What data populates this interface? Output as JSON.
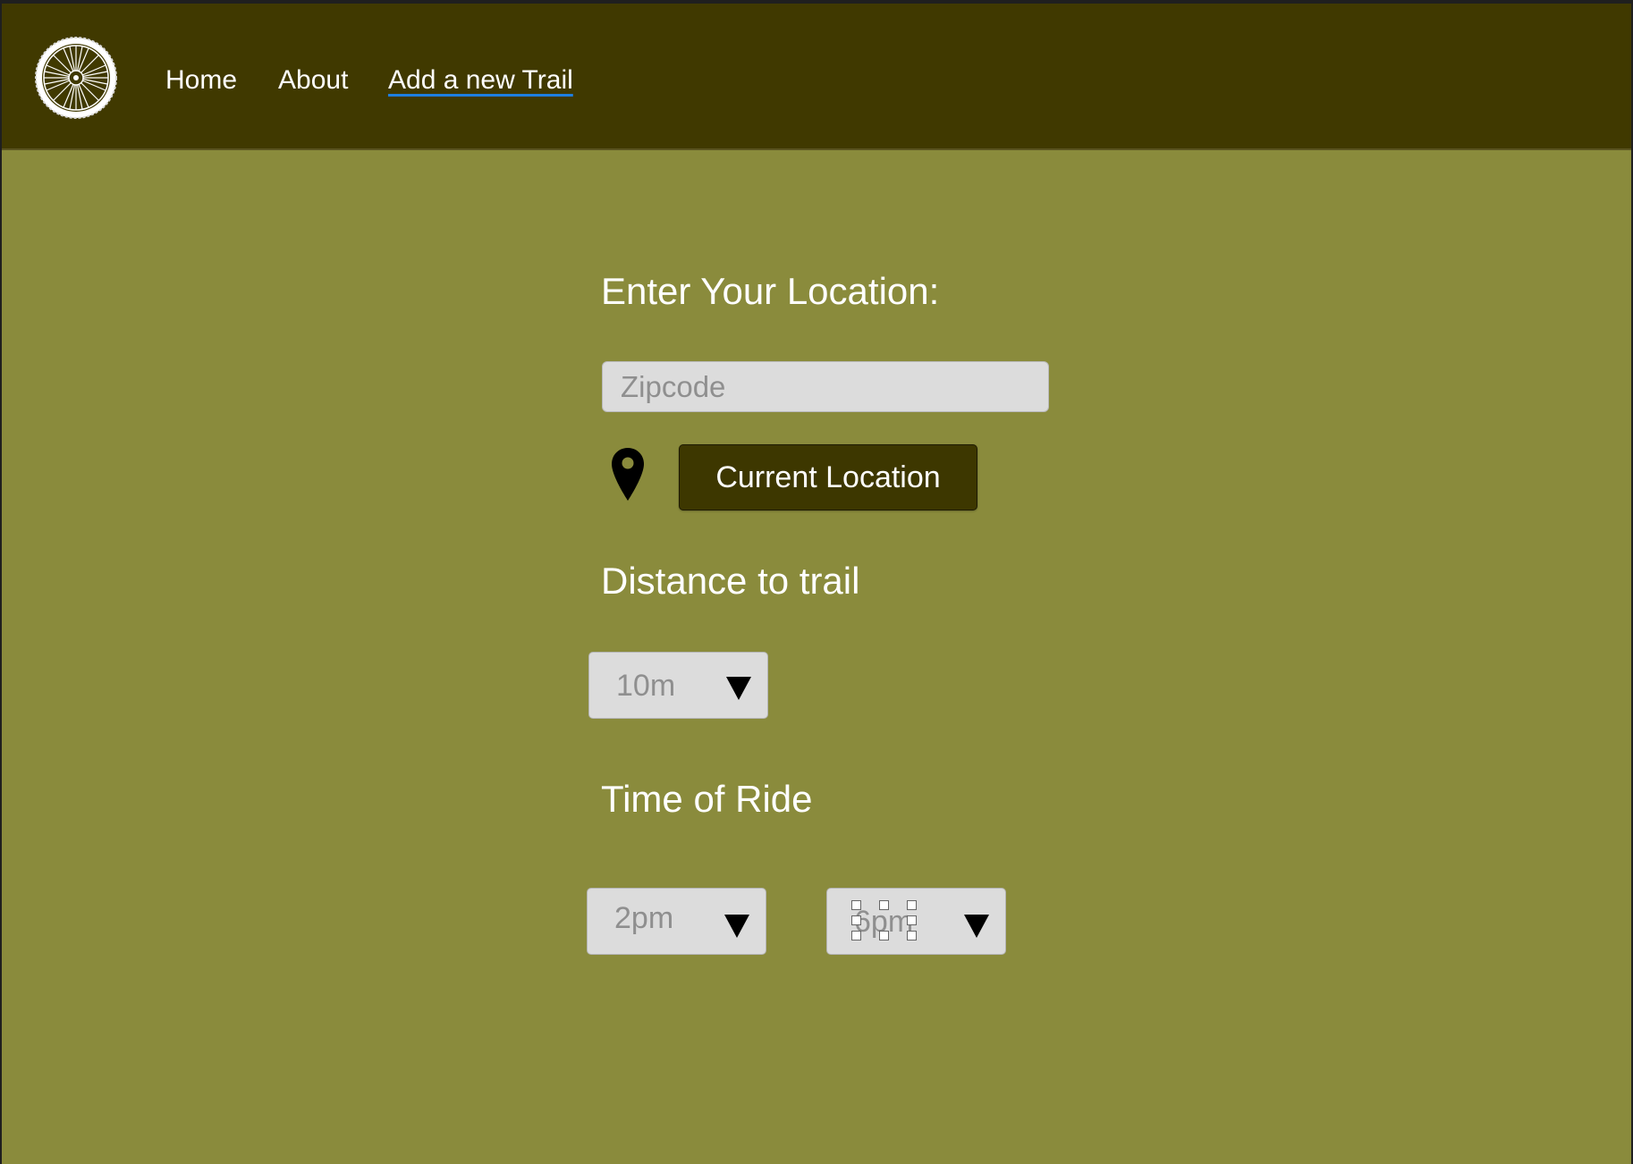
{
  "navbar": {
    "logo_icon": "bike-wheel-icon",
    "links": [
      {
        "label": "Home"
      },
      {
        "label": "About"
      },
      {
        "label": "Add a new Trail",
        "active": true
      }
    ]
  },
  "location": {
    "heading": "Enter Your Location:",
    "zip_placeholder": "Zipcode",
    "pin_icon": "map-pin-icon",
    "current_location_label": "Current Location"
  },
  "distance": {
    "heading": "Distance to trail",
    "selected": "10m"
  },
  "time": {
    "heading": "Time of Ride",
    "start_selected": "2pm",
    "end_selected": "6pm"
  },
  "colors": {
    "navbar_bg": "#403900",
    "page_bg": "#8a8b3c",
    "button_bg": "#3d3700",
    "active_underline": "#1e7fe0"
  }
}
